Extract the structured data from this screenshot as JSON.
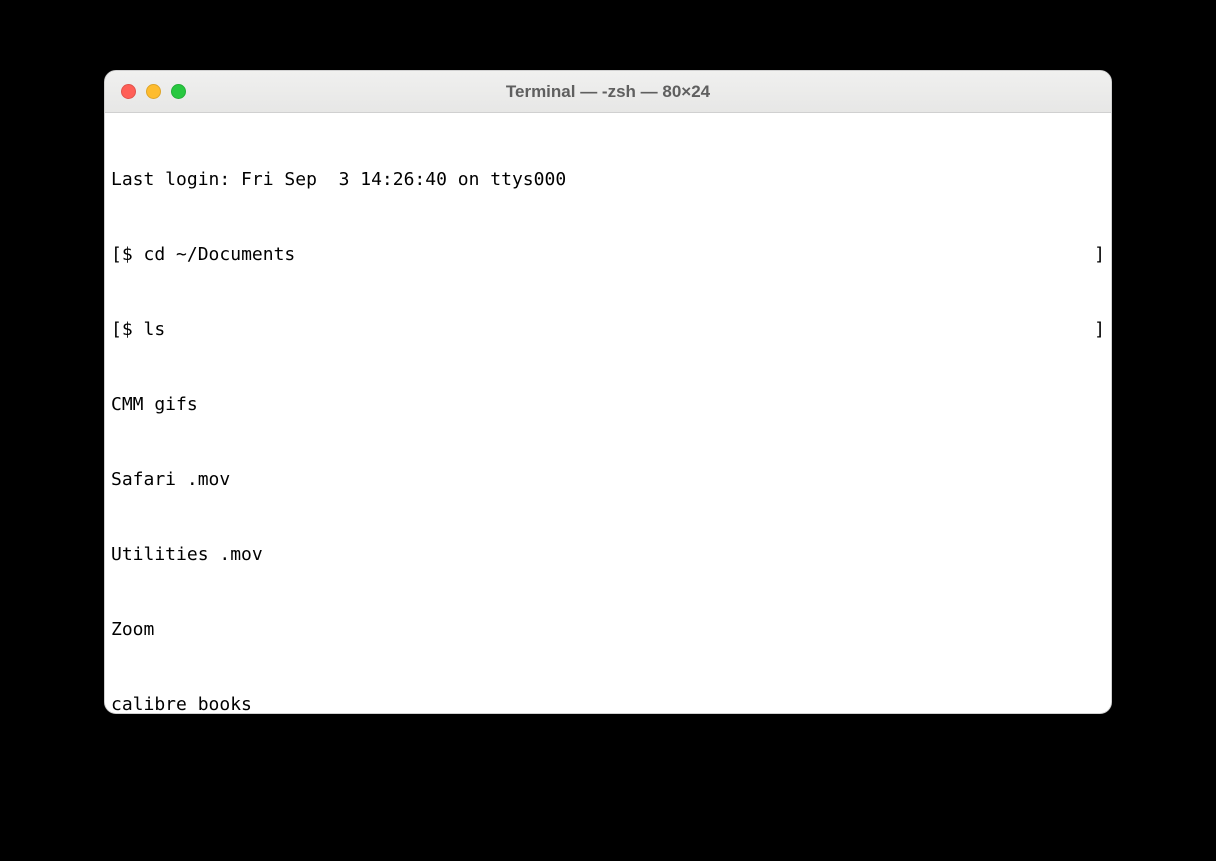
{
  "window": {
    "title": "Terminal — -zsh — 80×24"
  },
  "terminal": {
    "last_login": "Last login: Fri Sep  3 14:26:40 on ttys000",
    "prompt": "$",
    "commands": {
      "cd": "cd ~/Documents",
      "ls": "ls"
    },
    "ls_output": [
      "CMM gifs",
      "Safari .mov",
      "Utilities .mov",
      "Zoom",
      "calibre books"
    ],
    "bracket_left": "[",
    "bracket_right": "]"
  }
}
